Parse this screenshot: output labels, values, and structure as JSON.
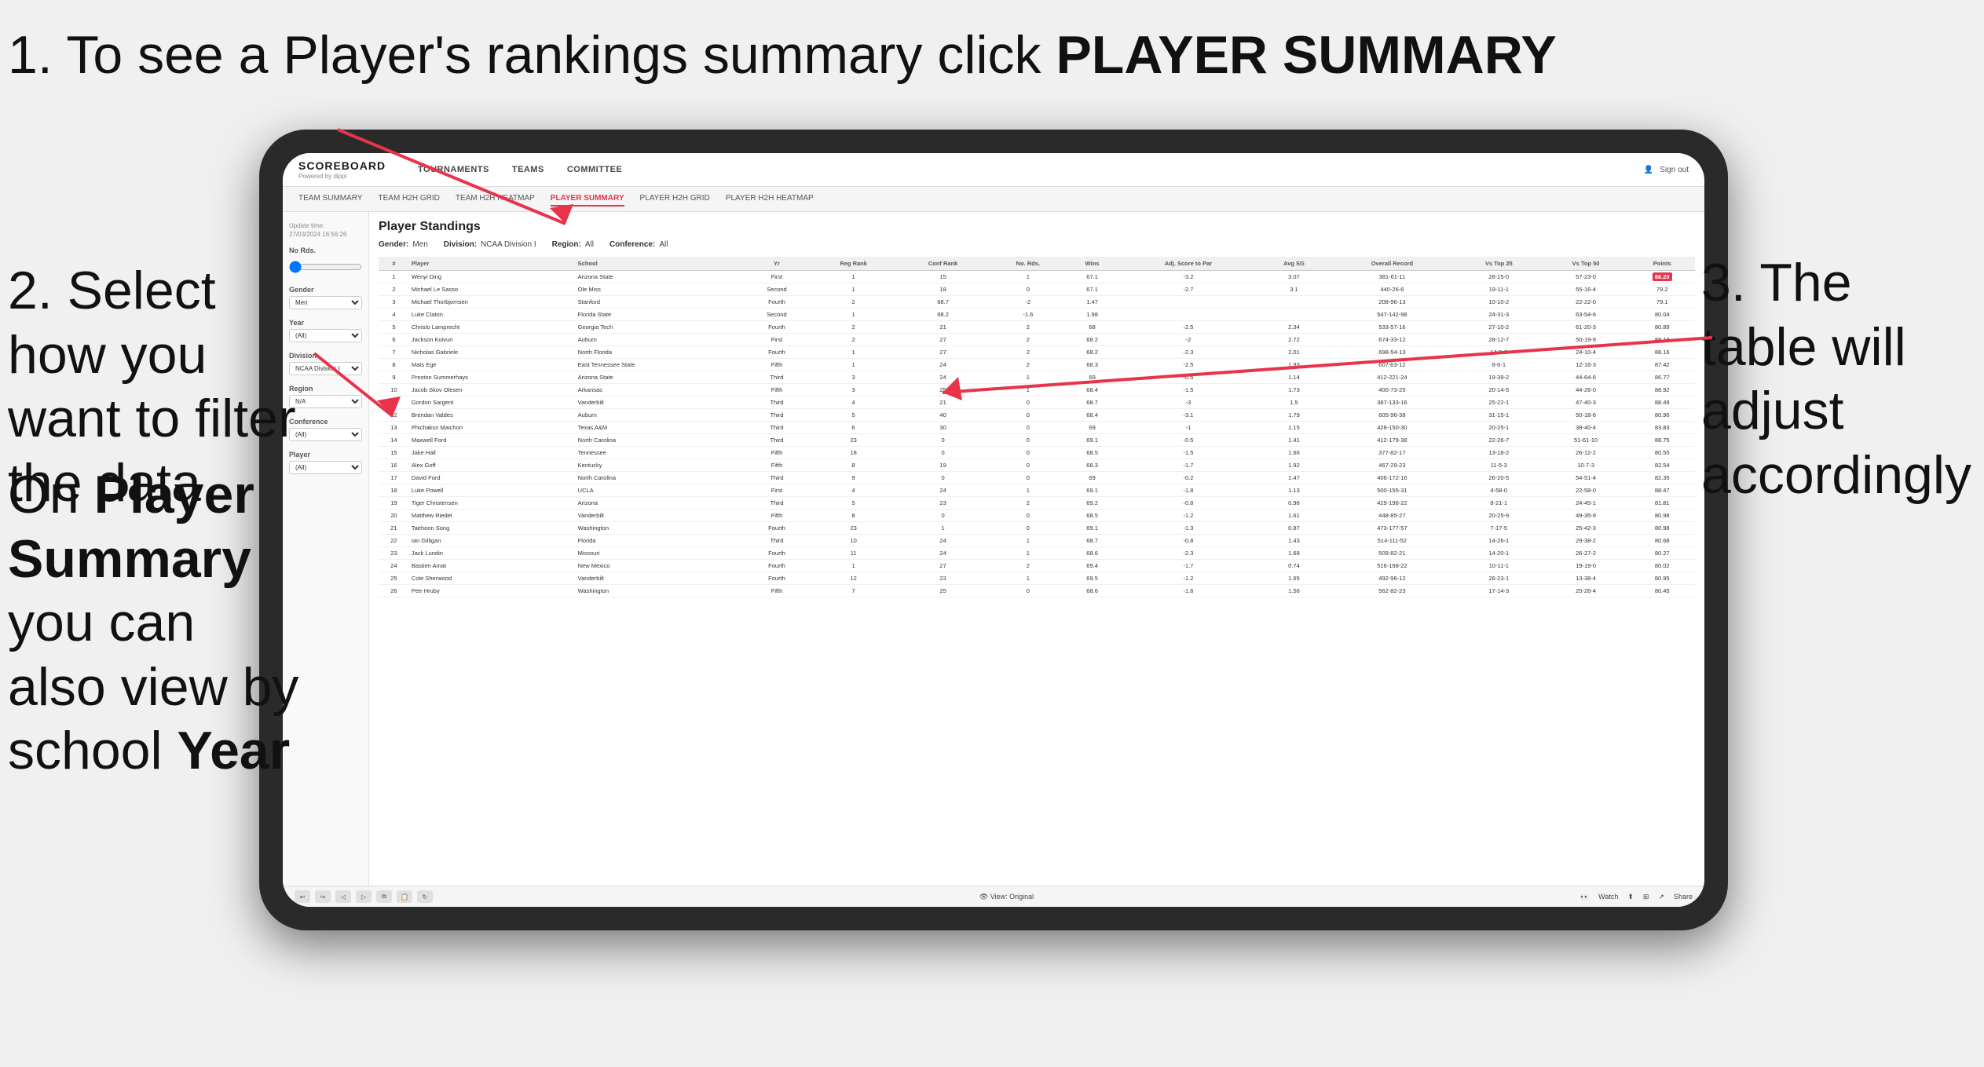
{
  "page": {
    "background": "#f0f0f0"
  },
  "annotations": {
    "step1": {
      "number": "1.",
      "text": "To see a Player's rankings summary click ",
      "bold": "PLAYER SUMMARY"
    },
    "step2": {
      "number": "2.",
      "text": "Select how you want to filter the data"
    },
    "step3": {
      "text": "3. The table will adjust accordingly"
    },
    "bottom": {
      "text": "On ",
      "bold1": "Player Summary",
      "text2": " you can also view by school ",
      "bold2": "Year"
    }
  },
  "tablet": {
    "header": {
      "logo": "SCOREBOARD",
      "logo_sub": "Powered by dippi",
      "nav": [
        "TOURNAMENTS",
        "TEAMS",
        "COMMITTEE"
      ],
      "header_right_icon": "person-icon",
      "sign_out": "Sign out"
    },
    "subnav": [
      "TEAM SUMMARY",
      "TEAM H2H GRID",
      "TEAM H2H HEATMAP",
      "PLAYER SUMMARY",
      "PLAYER H2H GRID",
      "PLAYER H2H HEATMAP"
    ],
    "active_subnav": "PLAYER SUMMARY",
    "sidebar": {
      "update_label": "Update time:",
      "update_time": "27/03/2024 16:56:26",
      "no_rds_label": "No Rds.",
      "gender_label": "Gender",
      "gender_value": "Men",
      "year_label": "Year",
      "year_value": "(All)",
      "division_label": "Division",
      "division_value": "NCAA Division I",
      "region_label": "Region",
      "region_value": "N/A",
      "conference_label": "Conference",
      "conference_value": "(All)",
      "player_label": "Player",
      "player_value": "(All)"
    },
    "table": {
      "title": "Player Standings",
      "filters": {
        "gender_label": "Gender:",
        "gender_value": "Men",
        "division_label": "Division:",
        "division_value": "NCAA Division I",
        "region_label": "Region:",
        "region_value": "All",
        "conference_label": "Conference:",
        "conference_value": "All"
      },
      "columns": [
        "#",
        "Player",
        "School",
        "Yr",
        "Reg Rank",
        "Conf Rank",
        "No. Rds.",
        "Wins",
        "Adj. Score to Par",
        "Avg SG",
        "Overall Record",
        "Vs Top 25",
        "Vs Top 50",
        "Points"
      ],
      "rows": [
        {
          "rank": 1,
          "player": "Wenyi Ding",
          "school": "Arizona State",
          "yr": "First",
          "reg_rank": 1,
          "conf_rank": 15,
          "rds": 1,
          "wins": 67.1,
          "adj": -3.2,
          "avg_sg": 3.07,
          "overall": "381-61-11",
          "record": "28-15-0",
          "vt25": "57-23-0",
          "vt50": "88.20",
          "points": "88.20",
          "highlight": true
        },
        {
          "rank": 2,
          "player": "Michael Le Sasso",
          "school": "Ole Miss",
          "yr": "Second",
          "reg_rank": 1,
          "conf_rank": 18,
          "rds": 0,
          "wins": 67.1,
          "adj": -2.7,
          "avg_sg": 3.1,
          "overall": "440-26-6",
          "record": "19-11-1",
          "vt25": "55-16-4",
          "vt50": "79.2"
        },
        {
          "rank": 3,
          "player": "Michael Thorbjornsen",
          "school": "Stanford",
          "yr": "Fourth",
          "reg_rank": 2,
          "conf_rank": 68.7,
          "rds": -2.0,
          "wins": 1.47,
          "adj": "",
          "overall": "208-96-13",
          "record": "10-10-2",
          "vt25": "22-22-0",
          "vt50": "79.1"
        },
        {
          "rank": 4,
          "player": "Luke Claton",
          "school": "Florida State",
          "yr": "Second",
          "reg_rank": 1,
          "conf_rank": 68.2,
          "rds": -1.6,
          "wins": 1.98,
          "adj": "",
          "overall": "547-142-98",
          "record": "24-31-3",
          "vt25": "63-54-6",
          "vt50": "80.04"
        },
        {
          "rank": 5,
          "player": "Christo Lamprecht",
          "school": "Georgia Tech",
          "yr": "Fourth",
          "reg_rank": 2,
          "conf_rank": 21,
          "rds": 2,
          "wins": 68.0,
          "adj": -2.5,
          "avg_sg": 2.34,
          "overall": "533-57-16",
          "record": "27-10-2",
          "vt25": "61-20-3",
          "vt50": "80.89"
        },
        {
          "rank": 6,
          "player": "Jackson Koivun",
          "school": "Auburn",
          "yr": "First",
          "reg_rank": 2,
          "conf_rank": 27,
          "rds": 2,
          "wins": 68.2,
          "adj": -2.0,
          "avg_sg": 2.72,
          "overall": "674-33-12",
          "record": "28-12-7",
          "vt25": "50-19-9",
          "vt50": "88.18"
        },
        {
          "rank": 7,
          "player": "Nicholas Gabriele",
          "school": "North Florida",
          "yr": "Fourth",
          "reg_rank": 1,
          "conf_rank": 27,
          "rds": 2,
          "wins": 68.2,
          "adj": -2.3,
          "avg_sg": 2.01,
          "overall": "698-54-13",
          "record": "14-5-3",
          "vt25": "24-10-4",
          "vt50": "88.16"
        },
        {
          "rank": 8,
          "player": "Mats Ege",
          "school": "East Tennessee State",
          "yr": "Fifth",
          "reg_rank": 1,
          "conf_rank": 24,
          "rds": 2,
          "wins": 68.3,
          "adj": -2.5,
          "avg_sg": 1.93,
          "overall": "607-63-12",
          "record": "8-6-1",
          "vt25": "12-16-3",
          "vt50": "87.42"
        },
        {
          "rank": 9,
          "player": "Preston Summerhays",
          "school": "Arizona State",
          "yr": "Third",
          "reg_rank": 3,
          "conf_rank": 24,
          "rds": 1,
          "wins": 69.0,
          "adj": -0.5,
          "avg_sg": 1.14,
          "overall": "412-221-24",
          "record": "19-39-2",
          "vt25": "44-64-6",
          "vt50": "86.77"
        },
        {
          "rank": 10,
          "player": "Jacob Skov Olesen",
          "school": "Arkansas",
          "yr": "Fifth",
          "reg_rank": 3,
          "conf_rank": 25,
          "rds": 1,
          "wins": 68.4,
          "adj": -1.5,
          "avg_sg": 1.73,
          "overall": "400-73-25",
          "record": "20-14-5",
          "vt25": "44-26-0",
          "vt50": "88.92"
        },
        {
          "rank": 11,
          "player": "Gordon Sargent",
          "school": "Vanderbilt",
          "yr": "Third",
          "reg_rank": 4,
          "conf_rank": 21,
          "rds": 0,
          "wins": 68.7,
          "adj": -3.0,
          "avg_sg": 1.5,
          "overall": "387-133-16",
          "record": "25-22-1",
          "vt25": "47-40-3",
          "vt50": "88.49"
        },
        {
          "rank": 12,
          "player": "Brendan Valdes",
          "school": "Auburn",
          "yr": "Third",
          "reg_rank": 5,
          "conf_rank": 40,
          "rds": 0,
          "wins": 68.4,
          "adj": -3.1,
          "avg_sg": 1.79,
          "overall": "605-96-38",
          "record": "31-15-1",
          "vt25": "50-18-6",
          "vt50": "80.96"
        },
        {
          "rank": 13,
          "player": "Phichaksn Maichon",
          "school": "Texas A&M",
          "yr": "Third",
          "reg_rank": 6,
          "conf_rank": 30,
          "rds": 0,
          "wins": 69.0,
          "adj": -1.0,
          "avg_sg": 1.15,
          "overall": "428-150-30",
          "record": "20-25-1",
          "vt25": "38-40-4",
          "vt50": "83.83"
        },
        {
          "rank": 14,
          "player": "Maxwell Ford",
          "school": "North Carolina",
          "yr": "Third",
          "reg_rank": 23,
          "conf_rank": 0,
          "rds": 0,
          "wins": 69.1,
          "adj": -0.5,
          "avg_sg": 1.41,
          "overall": "412-179-38",
          "record": "22-26-7",
          "vt25": "51-61-10",
          "vt50": "88.75"
        },
        {
          "rank": 15,
          "player": "Jake Hall",
          "school": "Tennessee",
          "yr": "Fifth",
          "reg_rank": 18,
          "conf_rank": 0,
          "rds": 0,
          "wins": 68.5,
          "adj": -1.5,
          "avg_sg": 1.66,
          "overall": "377-82-17",
          "record": "13-18-2",
          "vt25": "26-12-2",
          "vt50": "80.55"
        },
        {
          "rank": 16,
          "player": "Alex Goff",
          "school": "Kentucky",
          "yr": "Fifth",
          "reg_rank": 8,
          "conf_rank": 19,
          "rds": 0,
          "wins": 68.3,
          "adj": -1.7,
          "avg_sg": 1.92,
          "overall": "467-29-23",
          "record": "11-5-3",
          "vt25": "10-7-3",
          "vt50": "82.54"
        },
        {
          "rank": 17,
          "player": "David Ford",
          "school": "North Carolina",
          "yr": "Third",
          "reg_rank": 9,
          "conf_rank": 0,
          "rds": 0,
          "wins": 69.0,
          "adj": -0.2,
          "avg_sg": 1.47,
          "overall": "406-172-16",
          "record": "26-20-5",
          "vt25": "54-51-4",
          "vt50": "82.35"
        },
        {
          "rank": 18,
          "player": "Luke Powell",
          "school": "UCLA",
          "yr": "First",
          "reg_rank": 4,
          "conf_rank": 24,
          "rds": 1,
          "wins": 69.1,
          "adj": -1.8,
          "avg_sg": 1.13,
          "overall": "500-155-31",
          "record": "4-58-0",
          "vt25": "22-58-0",
          "vt50": "88.47"
        },
        {
          "rank": 19,
          "player": "Tiger Christensen",
          "school": "Arizona",
          "yr": "Third",
          "reg_rank": 5,
          "conf_rank": 23,
          "rds": 2,
          "wins": 69.2,
          "adj": -0.8,
          "avg_sg": 0.96,
          "overall": "429-198-22",
          "record": "8-21-1",
          "vt25": "24-45-1",
          "vt50": "81.81"
        },
        {
          "rank": 20,
          "player": "Matthew Riedel",
          "school": "Vanderbilt",
          "yr": "Fifth",
          "reg_rank": 8,
          "conf_rank": 0,
          "rds": 0,
          "wins": 68.5,
          "adj": -1.2,
          "avg_sg": 1.61,
          "overall": "448-85-27",
          "record": "20-25-9",
          "vt25": "49-35-9",
          "vt50": "80.98"
        },
        {
          "rank": 21,
          "player": "Taehoon Song",
          "school": "Washington",
          "yr": "Fourth",
          "reg_rank": 23,
          "conf_rank": 1,
          "rds": 0,
          "wins": 69.1,
          "adj": -1.3,
          "avg_sg": 0.87,
          "overall": "473-177-57",
          "record": "7-17-5",
          "vt25": "25-42-3",
          "vt50": "80.98"
        },
        {
          "rank": 22,
          "player": "Ian Gilligan",
          "school": "Florida",
          "yr": "Third",
          "reg_rank": 10,
          "conf_rank": 24,
          "rds": 1,
          "wins": 68.7,
          "adj": -0.8,
          "avg_sg": 1.43,
          "overall": "514-111-52",
          "record": "14-26-1",
          "vt25": "29-38-2",
          "vt50": "80.68"
        },
        {
          "rank": 23,
          "player": "Jack Lundin",
          "school": "Missouri",
          "yr": "Fourth",
          "reg_rank": 11,
          "conf_rank": 24,
          "rds": 1,
          "wins": 68.6,
          "adj": -2.3,
          "avg_sg": 1.68,
          "overall": "509-82-21",
          "record": "14-20-1",
          "vt25": "26-27-2",
          "vt50": "80.27"
        },
        {
          "rank": 24,
          "player": "Bastien Amat",
          "school": "New Mexico",
          "yr": "Fourth",
          "reg_rank": 1,
          "conf_rank": 27,
          "rds": 2,
          "wins": 69.4,
          "adj": -1.7,
          "avg_sg": 0.74,
          "overall": "516-168-22",
          "record": "10-11-1",
          "vt25": "19-19-0",
          "vt50": "80.02"
        },
        {
          "rank": 25,
          "player": "Cole Sherwood",
          "school": "Vanderbilt",
          "yr": "Fourth",
          "reg_rank": 12,
          "conf_rank": 23,
          "rds": 1,
          "wins": 69.5,
          "adj": -1.2,
          "avg_sg": 1.65,
          "overall": "492-96-12",
          "record": "26-23-1",
          "vt25": "13-38-4",
          "vt50": "80.95"
        },
        {
          "rank": 26,
          "player": "Petr Hruby",
          "school": "Washington",
          "yr": "Fifth",
          "reg_rank": 7,
          "conf_rank": 25,
          "rds": 0,
          "wins": 68.6,
          "adj": -1.6,
          "avg_sg": 1.56,
          "overall": "562-82-23",
          "record": "17-14-3",
          "vt25": "25-26-4",
          "vt50": "80.45"
        }
      ]
    },
    "toolbar": {
      "view": "View: Original",
      "watch": "Watch",
      "share": "Share"
    }
  }
}
